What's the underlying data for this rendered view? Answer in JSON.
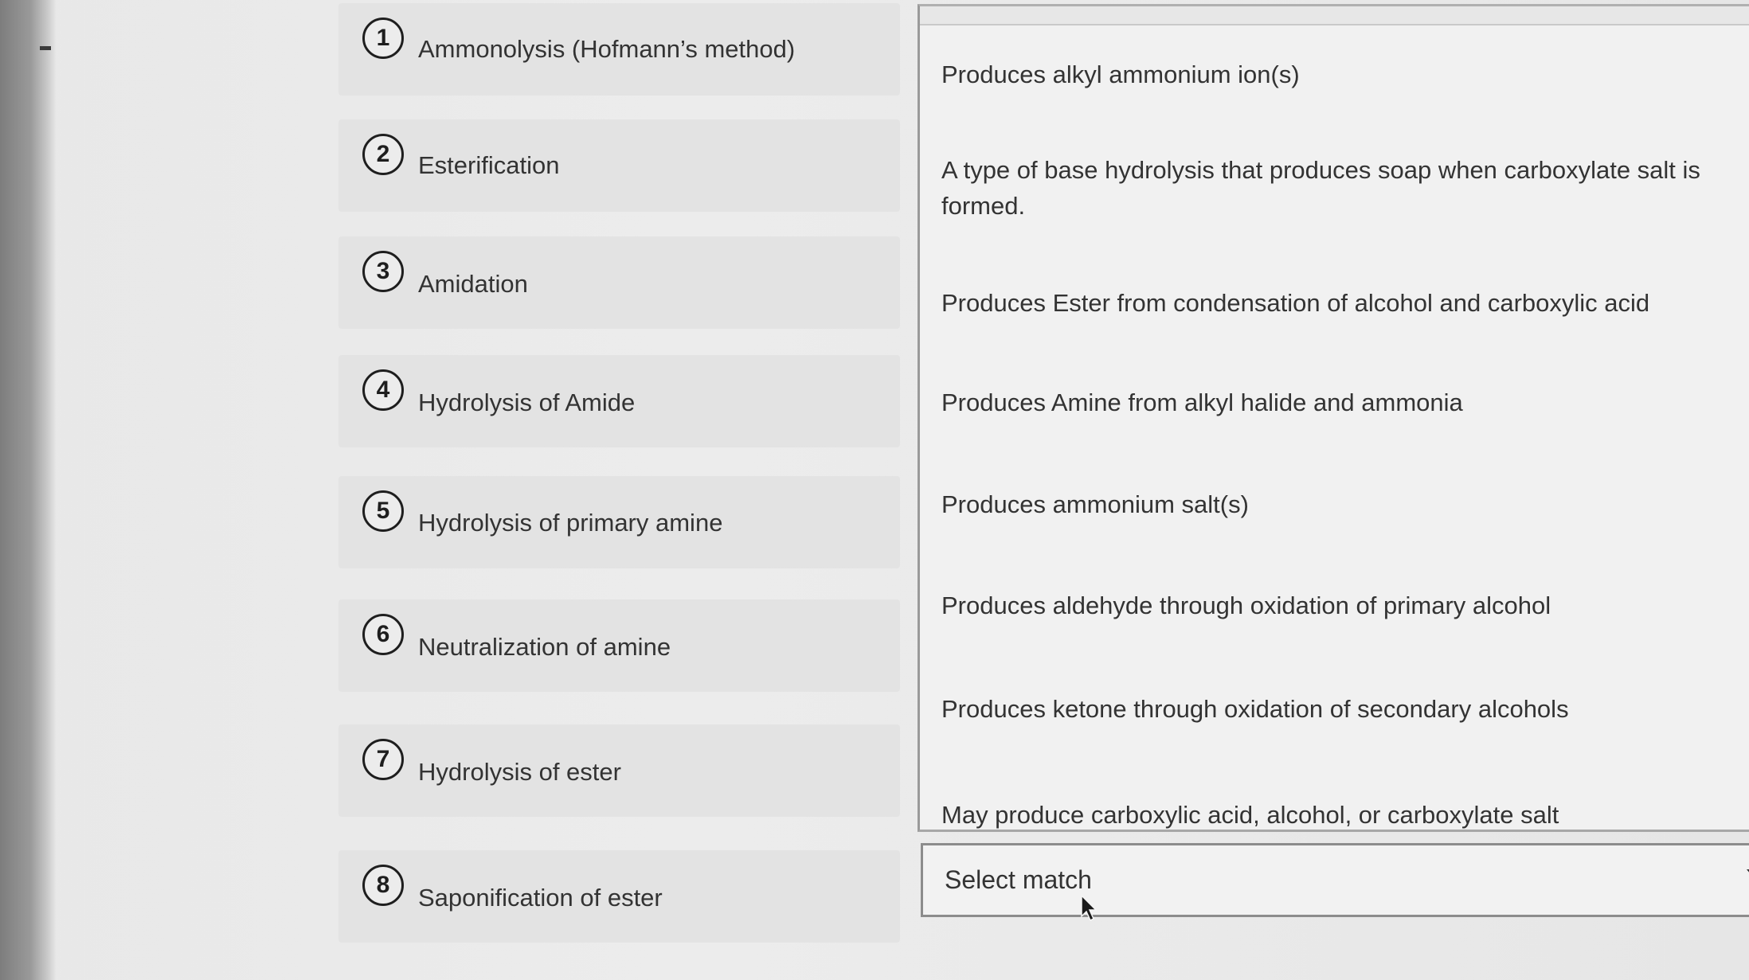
{
  "terms": [
    {
      "number": "1",
      "label": "Ammonolysis (Hofmann’s method)"
    },
    {
      "number": "2",
      "label": "Esterification"
    },
    {
      "number": "3",
      "label": "Amidation"
    },
    {
      "number": "4",
      "label": "Hydrolysis of Amide"
    },
    {
      "number": "5",
      "label": "Hydrolysis of primary amine"
    },
    {
      "number": "6",
      "label": "Neutralization of amine"
    },
    {
      "number": "7",
      "label": "Hydrolysis of ester"
    },
    {
      "number": "8",
      "label": "Saponification of ester"
    }
  ],
  "descriptions": [
    "Produces alkyl ammonium ion(s)",
    "A type of base hydrolysis that produces soap when carboxylate salt is formed.",
    "Produces Ester from condensation of alcohol and carboxylic acid",
    "Produces Amine from alkyl halide and ammonia",
    "Produces ammonium salt(s)",
    "Produces aldehyde through oxidation of primary alcohol",
    "Produces ketone through oxidation of secondary alcohols",
    "May produce carboxylic acid, alcohol, or carboxylate salt"
  ],
  "select": {
    "value": "Select match"
  },
  "icons": {
    "dropdown": "chevron-down-icon",
    "pointer": "mouse-cursor-icon"
  }
}
